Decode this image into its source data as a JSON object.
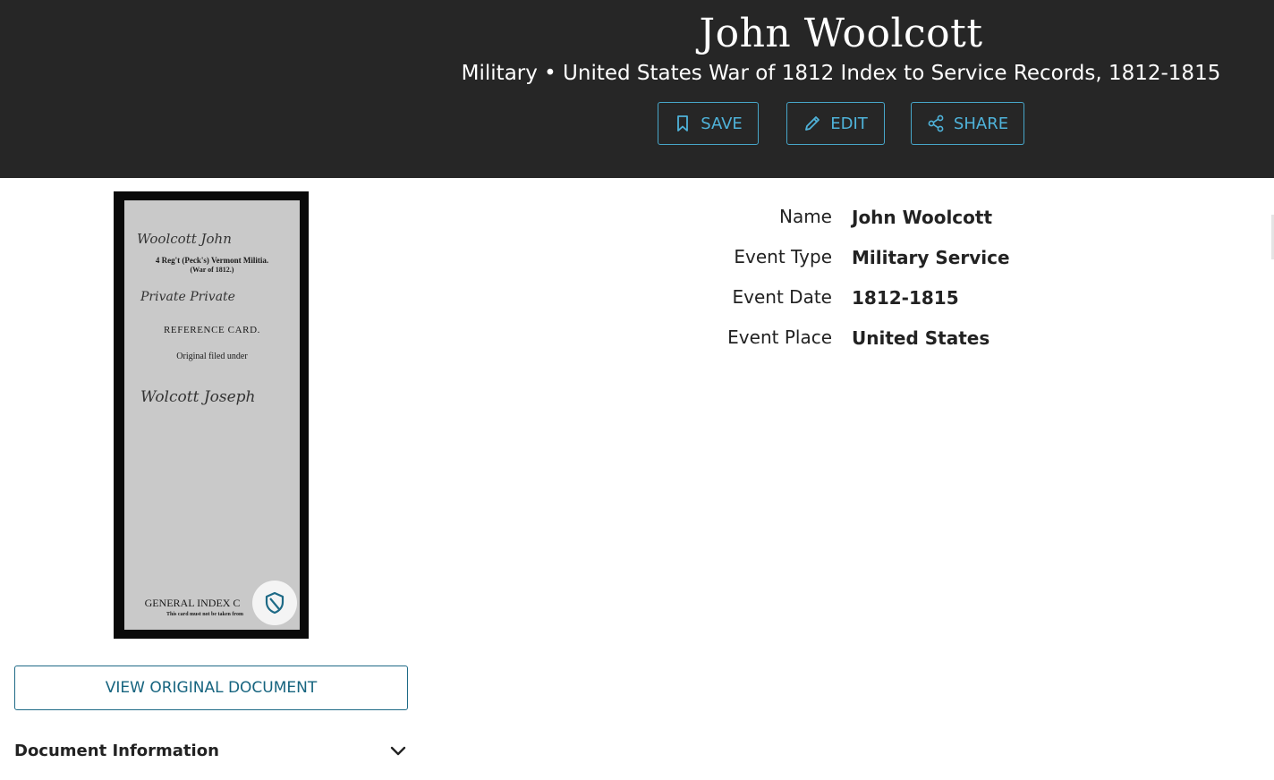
{
  "header": {
    "title": "John Woolcott",
    "subtitle": "Military • United States War of 1812 Index to Service Records, 1812-1815",
    "buttons": {
      "save_label": "SAVE",
      "edit_label": "EDIT",
      "share_label": "SHARE"
    },
    "colors": {
      "background": "#262626",
      "accent": "#4fb3da"
    }
  },
  "document_image": {
    "card_lines": {
      "handwritten_name": "Woolcott John",
      "regiment": "4 Reg't (Peck's) Vermont Militia.",
      "war": "(War of 1812.)",
      "rank": "Private Private",
      "reference": "REFERENCE CARD.",
      "original_filed": "Original filed under",
      "filed_name": "Wolcott Joseph",
      "footer": "GENERAL INDEX C",
      "footer_note": "This card must not be taken from"
    },
    "badge_icon": "shield-icon"
  },
  "view_original_label": "VIEW ORIGINAL DOCUMENT",
  "document_information": {
    "label": "Document Information",
    "icon": "chevron-down-icon"
  },
  "facts": [
    {
      "label": "Name",
      "value": "John Woolcott"
    },
    {
      "label": "Event Type",
      "value": "Military Service"
    },
    {
      "label": "Event Date",
      "value": "1812-1815"
    },
    {
      "label": "Event Place",
      "value": "United States"
    }
  ]
}
